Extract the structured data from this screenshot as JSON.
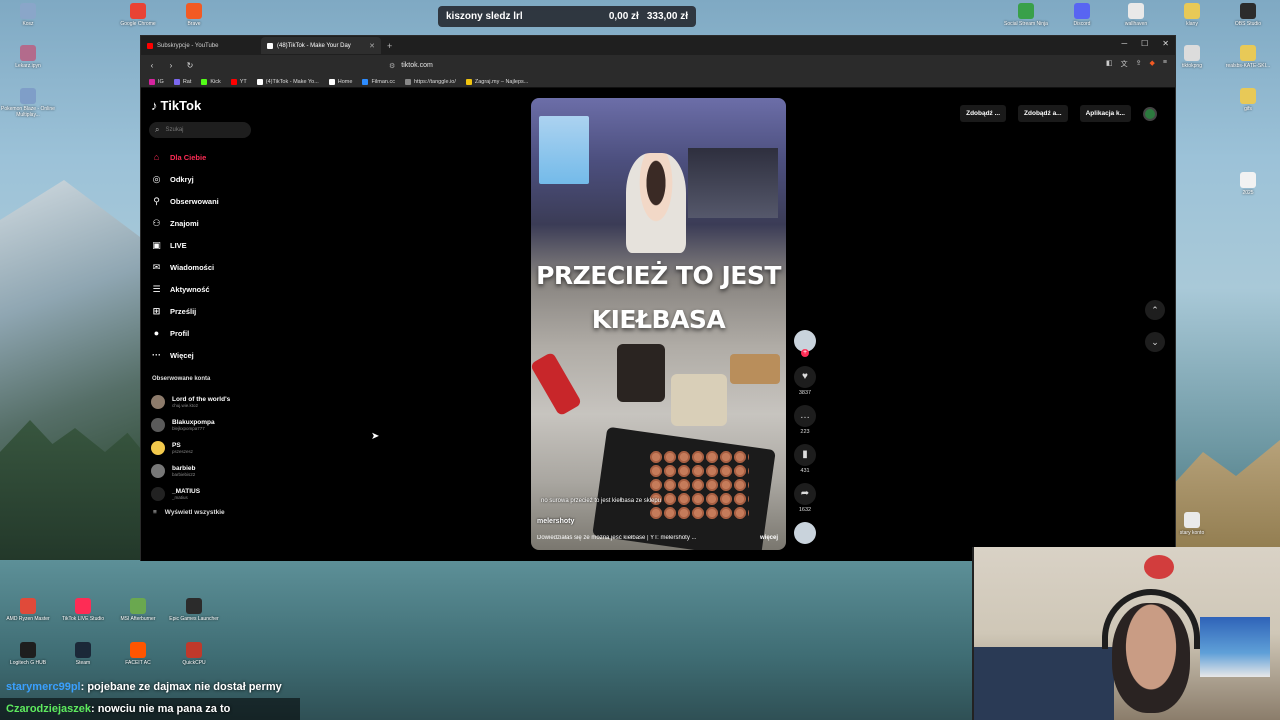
{
  "desktop": {
    "icons_top": [
      {
        "label": "Kosz",
        "color": "#8aa6c9"
      },
      {
        "label": "Google Chrome",
        "color": "#e94335"
      },
      {
        "label": "Brave",
        "color": "#f25a23"
      },
      {
        "label": "Social Stream Ninja",
        "color": "#39a04a"
      },
      {
        "label": "Discord",
        "color": "#5865f2"
      },
      {
        "label": "wallhaven",
        "color": "#e9e9e9"
      },
      {
        "label": "klany",
        "color": "#e8c957"
      },
      {
        "label": "OBS Studio",
        "color": "#2c2c2c"
      }
    ],
    "icons_left": [
      {
        "label": "Lekarz.ipyn",
        "color": "#b36b8c"
      },
      {
        "label": "Pokemon Blaze - Online Multiplay...",
        "color": "#7f9ec8"
      }
    ],
    "icons_right": [
      {
        "label": "tiktokpng",
        "color": "#dcdcdc"
      },
      {
        "label": "realsbs-KATE-SKI...",
        "color": "#e8c957"
      },
      {
        "label": "gifs",
        "color": "#e8c957"
      },
      {
        "label": "2025",
        "color": "#f2f2f2"
      },
      {
        "label": "stary konto",
        "color": "#eaeaea"
      }
    ],
    "icons_bottom": [
      {
        "label": "AMD Ryzen Master",
        "color": "#e04a3a"
      },
      {
        "label": "TikTok LIVE Studio",
        "color": "#fe2c55"
      },
      {
        "label": "MSI Afterburner",
        "color": "#6aa84f"
      },
      {
        "label": "Epic Games Launcher",
        "color": "#2b2b2b"
      },
      {
        "label": "Logitech G HUB",
        "color": "#1e1e1e"
      },
      {
        "label": "Steam",
        "color": "#1b2838"
      },
      {
        "label": "FACEIT AC",
        "color": "#ff5500"
      },
      {
        "label": "QuickCPU",
        "color": "#c0392b"
      }
    ]
  },
  "overlay": {
    "name": "kiszony sledz lrl",
    "amount1": "0,00 zł",
    "amount2": "333,00 zł"
  },
  "browser": {
    "tabs": [
      {
        "label": "Subskrypcje - YouTube",
        "color": "#ff0000"
      },
      {
        "label": "(48)TikTok - Make Your Day",
        "color": "#ffffff"
      }
    ],
    "new_tab": "+",
    "url": "tiktok.com",
    "bookmarks": [
      {
        "label": "IG",
        "color": "#d6249f"
      },
      {
        "label": "Rat",
        "color": "#7b68ee"
      },
      {
        "label": "Kick",
        "color": "#53fc18"
      },
      {
        "label": "YT",
        "color": "#ff0000"
      },
      {
        "label": "(4)TikTok - Make Yo...",
        "color": "#ffffff"
      },
      {
        "label": "Home",
        "color": "#ffffff"
      },
      {
        "label": "Filman.cc",
        "color": "#2d8cff"
      },
      {
        "label": "https://tanggle.io/",
        "color": "#888888"
      },
      {
        "label": "Zagraj.my – Najleps...",
        "color": "#f1c40f"
      }
    ]
  },
  "tiktok": {
    "logo": "TikTok",
    "search_placeholder": "Szukaj",
    "menu": [
      {
        "label": "Dla Ciebie",
        "icon": "home-icon",
        "glyph": "⌂",
        "active": true
      },
      {
        "label": "Odkryj",
        "icon": "compass-icon",
        "glyph": "◎",
        "active": false
      },
      {
        "label": "Obserwowani",
        "icon": "following-icon",
        "glyph": "⚲",
        "active": false
      },
      {
        "label": "Znajomi",
        "icon": "friends-icon",
        "glyph": "⚇",
        "active": false
      },
      {
        "label": "LIVE",
        "icon": "live-icon",
        "glyph": "▣",
        "active": false
      },
      {
        "label": "Wiadomości",
        "icon": "messages-icon",
        "glyph": "✉",
        "active": false
      },
      {
        "label": "Aktywność",
        "icon": "activity-icon",
        "glyph": "☰",
        "active": false
      },
      {
        "label": "Prześlij",
        "icon": "upload-icon",
        "glyph": "⊞",
        "active": false
      },
      {
        "label": "Profil",
        "icon": "profile-icon",
        "glyph": "●",
        "active": false
      },
      {
        "label": "Więcej",
        "icon": "more-icon",
        "glyph": "···",
        "active": false
      }
    ],
    "followed_title": "Obserwowane konta",
    "followed": [
      {
        "name": "Lord of the world's",
        "handle": "chuj.wie.kto2",
        "color": "#8d7b6b"
      },
      {
        "name": "Blakuxpompa",
        "handle": "blejkxpompa777",
        "color": "#5a5a5a"
      },
      {
        "name": "PS",
        "handle": "pszeszesz",
        "color": "#f2c94c"
      },
      {
        "name": "barbieb",
        "handle": "barbiebis22",
        "color": "#777777"
      },
      {
        "name": "_MATIUS",
        "handle": "_matius",
        "color": "#222222"
      }
    ],
    "show_all": "Wyświetl wszystkie",
    "top_buttons": [
      "Zdobądź ...",
      "Zdobądź a...",
      "Aplikacja k..."
    ],
    "video": {
      "headline_1": "PRZECIEŻ TO JEST",
      "headline_2": "KIEŁBASA",
      "subtitle": "no surowa przecież to jest kiełbasa ze sklepu",
      "author": "melershoty",
      "description": "Dowiedziałaś się że można jeść kiełbase | YT: melershoty ...",
      "more": "więcej"
    },
    "stats": {
      "likes": "3837",
      "comments": "223",
      "saves": "431",
      "shares": "1632"
    }
  },
  "chat": [
    {
      "user": "starymerc99pl",
      "message": ": pojebane ze dajmax nie dostał permy"
    },
    {
      "user": "Czarodziejaszek",
      "message": ": nowciu nie ma pana za to"
    }
  ]
}
